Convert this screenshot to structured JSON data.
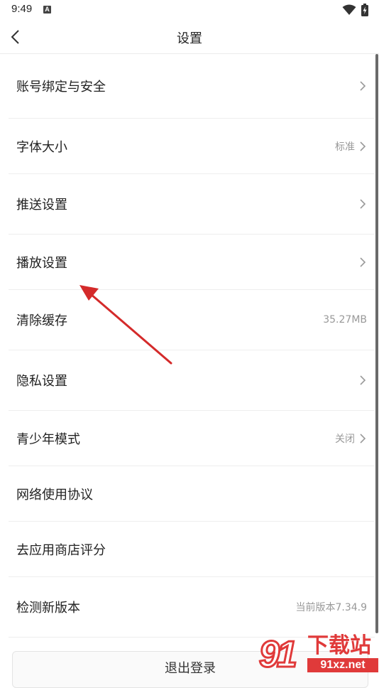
{
  "status_bar": {
    "time": "9:49",
    "notification_icon_letter": "A",
    "wifi_icon": "wifi-icon",
    "battery_icon": "battery-charging-icon"
  },
  "app_bar": {
    "title": "设置",
    "back_icon": "chevron-left-icon"
  },
  "settings": [
    {
      "label": "账号绑定与安全",
      "value": "",
      "chevron": true
    },
    {
      "label": "字体大小",
      "value": "标准",
      "chevron": true
    },
    {
      "label": "推送设置",
      "value": "",
      "chevron": true
    },
    {
      "label": "播放设置",
      "value": "",
      "chevron": true
    },
    {
      "label": "清除缓存",
      "value": "35.27MB",
      "chevron": false
    },
    {
      "label": "隐私设置",
      "value": "",
      "chevron": true
    },
    {
      "label": "青少年模式",
      "value": "关闭",
      "chevron": true
    },
    {
      "label": "网络使用协议",
      "value": "",
      "chevron": false
    },
    {
      "label": "去应用商店评分",
      "value": "",
      "chevron": false
    },
    {
      "label": "检测新版本",
      "value": "当前版本7.34.9",
      "chevron": false
    }
  ],
  "logout_label": "退出登录",
  "watermark": {
    "digits": "91",
    "site_name": "下载站",
    "url": "91xz.net"
  },
  "colors": {
    "annotation_arrow": "#d42a2a",
    "watermark_red": "#e03a3a",
    "secondary_text": "#999999"
  }
}
